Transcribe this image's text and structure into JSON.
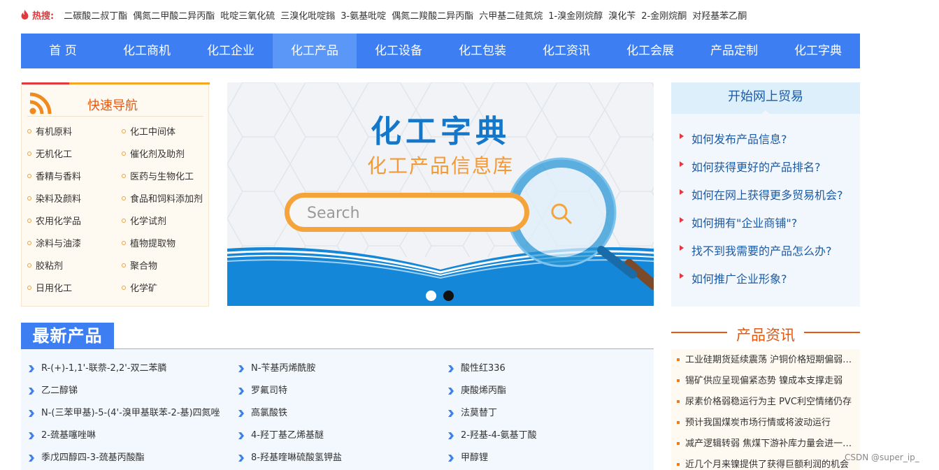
{
  "hot_search": {
    "label": "热搜:",
    "items": [
      "二碳酸二叔丁酯",
      "偶氮二甲酸二异丙酯",
      "吡啶三氧化硫",
      "三溴化吡啶鎓",
      "3-氨基吡啶",
      "偶氮二羧酸二异丙酯",
      "六甲基二硅氮烷",
      "1-溴金刚烷醇",
      "溴化苄",
      "2-金刚烷酮",
      "对羟基苯乙酮"
    ]
  },
  "nav": {
    "items": [
      "首 页",
      "化工商机",
      "化工企业",
      "化工产品",
      "化工设备",
      "化工包装",
      "化工资讯",
      "化工会展",
      "产品定制",
      "化工字典"
    ],
    "active_index": 3
  },
  "quick_nav": {
    "title": "快速导航",
    "items": [
      "有机原料",
      "化工中间体",
      "无机化工",
      "催化剂及助剂",
      "香精与香料",
      "医药与生物化工",
      "染料及颜料",
      "食品和饲料添加剂",
      "农用化学品",
      "化学试剂",
      "涂料与油漆",
      "植物提取物",
      "胶粘剂",
      "聚合物",
      "日用化工",
      "化学矿"
    ]
  },
  "banner": {
    "title": "化工字典",
    "subtitle": "化工产品信息库",
    "search_text": "Search",
    "slide_count": 2,
    "active_slide": 1
  },
  "trade": {
    "title": "开始网上贸易",
    "items": [
      "如何发布产品信息?",
      "如何获得更好的产品排名?",
      "如何在网上获得更多贸易机会?",
      "如何拥有\"企业商铺\"?",
      "找不到我需要的产品怎么办?",
      "如何推广企业形象?"
    ]
  },
  "latest": {
    "title": "最新产品",
    "items": [
      "R-(+)-1,1'-联萘-2,2'-双二苯膦",
      "N-苄基丙烯酰胺",
      "酸性红336",
      "乙二醇锑",
      "罗氟司特",
      "庚酸烯丙酯",
      "N-(三苯甲基)-5-(4'-溴甲基联苯-2-基)四氮唑",
      "高氯酸铁",
      "法莫替丁",
      "2-巯基噻唑啉",
      "4-羟丁基乙烯基醚",
      "2-羟基-4-氨基丁酸",
      "季戊四醇四-3-巯基丙酸酯",
      "8-羟基喹啉硫酸氢钾盐",
      "甲醇锂"
    ]
  },
  "news": {
    "title": "产品资讯",
    "items": [
      "工业硅期货延续震荡 沪铜价格短期偏弱运行",
      "锡矿供应呈现偏紧态势 镍成本支撑走弱",
      "尿素价格弱稳运行为主 PVC利空情绪仍存",
      "预计我国煤炭市场行情或将波动运行",
      "减产逻辑转弱 焦煤下游补库力量会进一步减弱",
      "近几个月来镍提供了获得巨额利润的机会"
    ]
  },
  "watermark": "CSDN @super_ip_",
  "colors": {
    "nav_bg": "#3d7ff3",
    "nav_active": "#5b97f7",
    "accent_orange": "#e4570e",
    "link_blue": "#1b5aa5"
  }
}
